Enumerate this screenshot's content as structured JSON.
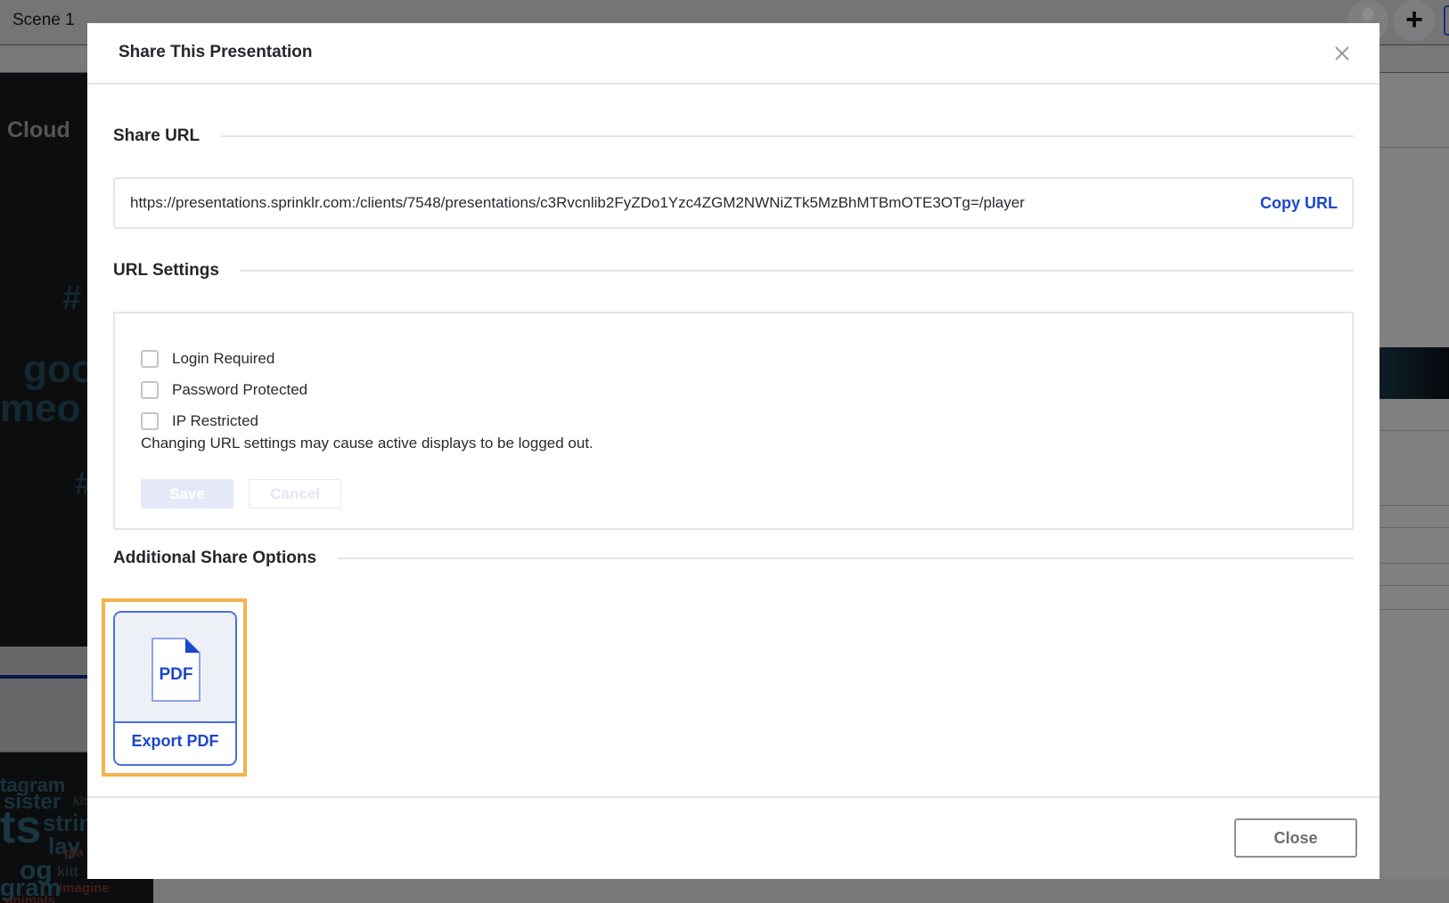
{
  "background": {
    "scene_title": "Scene 1",
    "panel_title": "Cloud",
    "cloud_words_top": [
      "#",
      "goo",
      "meo",
      "#"
    ],
    "cloud_words_bottom": [
      "tagram",
      "sister",
      "kitte",
      "ts",
      "strin",
      "lay",
      "pla",
      "og",
      "kitt",
      "gram",
      "imagine",
      "animals"
    ],
    "avatar_icon": "user-avatar-icon",
    "add_icon": "plus-icon"
  },
  "dialog": {
    "title": "Share This Presentation",
    "close_icon": "close-x-icon",
    "share_url": {
      "heading": "Share URL",
      "url": "https://presentations.sprinklr.com:/clients/7548/presentations/c3Rvcnlib2FyZDo1Yzc4ZGM2NWNiZTk5MzBhMTBmOTE3OTg=/player",
      "copy_label": "Copy URL"
    },
    "url_settings": {
      "heading": "URL Settings",
      "options": [
        {
          "label": "Login Required",
          "checked": false
        },
        {
          "label": "Password Protected",
          "checked": false
        },
        {
          "label": "IP Restricted",
          "checked": false
        }
      ],
      "note": "Changing URL settings may cause active displays to be logged out.",
      "save_label": "Save",
      "cancel_label": "Cancel"
    },
    "additional": {
      "heading": "Additional Share Options",
      "export_pdf": {
        "icon_text": "PDF",
        "label": "Export PDF"
      }
    },
    "footer": {
      "close_label": "Close"
    }
  },
  "colors": {
    "accent_blue": "#1d47c9",
    "highlight_orange": "#f2b34c",
    "disabled_button": "#e5e9f7"
  }
}
